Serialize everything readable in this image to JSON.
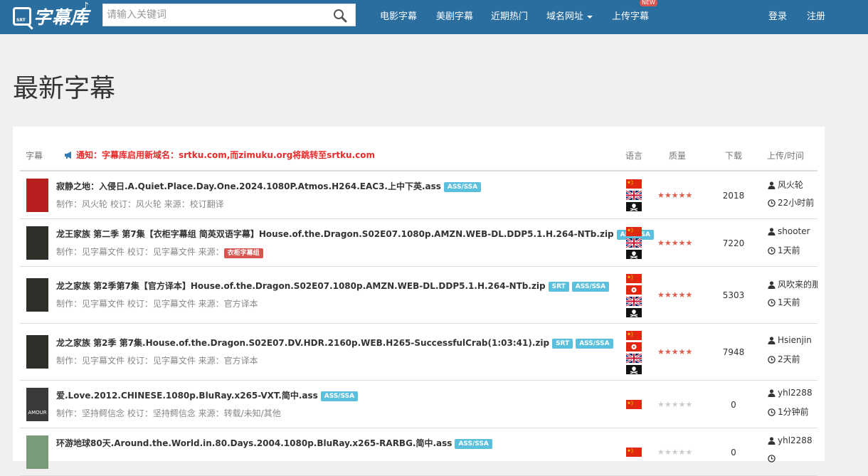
{
  "site": {
    "logo_text": "字幕库",
    "logo_mark_text": "SRT",
    "logo_note": "♪"
  },
  "search": {
    "placeholder": "请输入关键词"
  },
  "nav": {
    "items": [
      "电影字幕",
      "美剧字幕",
      "近期热门",
      "域名网址",
      "上传字幕"
    ],
    "new_badge": "NEW",
    "login": "登录",
    "register": "注册"
  },
  "page_title": "最新字幕",
  "table": {
    "headers": {
      "subtitle": "字幕",
      "language": "语言",
      "quality": "质量",
      "downloads": "下载",
      "uploader_time": "上传/时间"
    },
    "notice": "通知：字幕库启用新域名：srtku.com,而zimuku.org将跳转至srtku.com",
    "rows": [
      {
        "title": "寂静之地：入侵日.A.Quiet.Place.Day.One.2024.1080P.Atmos.H264.EAC3.上中下英.ass",
        "tags": [
          "ASS/SSA"
        ],
        "meta": "制作：风火轮 校订：风火轮 来源：校订翻译",
        "source_badge": "",
        "flags": [
          "cn",
          "uk",
          "skull"
        ],
        "stars": 5,
        "downloads": "2018",
        "uploader": "风火轮",
        "time": "22小时前",
        "poster_color": "#b71f1f"
      },
      {
        "title": "龙王家族 第二季 第7集【衣柜字幕组 简英双语字幕】House.of.the.Dragon.S02E07.1080p.AMZN.WEB-DL.DDP5.1.H.264-NTb.zip",
        "tags": [
          "ASS/SSA"
        ],
        "meta": "制作：见字幕文件 校订：见字幕文件 来源：",
        "source_badge": "衣柜字幕组",
        "flags": [
          "cn",
          "uk",
          "skull"
        ],
        "stars": 5,
        "downloads": "7220",
        "uploader": "shooter",
        "time": "1天前",
        "poster_color": "#2c3028"
      },
      {
        "title": "龙之家族 第2季第7集【官方译本】House.of.the.Dragon.S02E07.1080p.AMZN.WEB-DL.DDP5.1.H.264-NTb.zip",
        "tags": [
          "SRT",
          "ASS/SSA"
        ],
        "meta": "制作：见字幕文件 校订：见字幕文件 来源：官方译本",
        "source_badge": "",
        "flags": [
          "cn",
          "hk",
          "uk",
          "skull"
        ],
        "stars": 5,
        "downloads": "5303",
        "uploader": "风吹来的那",
        "time": "1天前",
        "poster_color": "#2c3028"
      },
      {
        "title": "龙之家族 第2季 第7集.House.of.the.Dragon.S02E07.DV.HDR.2160p.WEB.H265-SuccessfulCrab(1:03:41).zip",
        "tags": [
          "SRT",
          "ASS/SSA"
        ],
        "meta": "制作：见字幕文件 校订：见字幕文件 来源：官方译本",
        "source_badge": "",
        "flags": [
          "cn",
          "hk",
          "uk",
          "skull"
        ],
        "stars": 5,
        "downloads": "7948",
        "uploader": "Hsienjin",
        "time": "2天前",
        "poster_color": "#2c3028"
      },
      {
        "title": "爱.Love.2012.CHINESE.1080p.BluRay.x265-VXT.简中.ass",
        "tags": [
          "ASS/SSA"
        ],
        "meta": "制作：坚持鳄信念 校订：坚持鳄信念 来源：转载/未知/其他",
        "source_badge": "",
        "flags": [
          "cn"
        ],
        "stars": 0,
        "downloads": "0",
        "uploader": "yhl2288",
        "time": "1分钟前",
        "poster_color": "#3a3a3a",
        "poster_text": "AMOUR"
      },
      {
        "title": "环游地球80天.Around.the.World.in.80.Days.2004.1080p.BluRay.x265-RARBG.简中.ass",
        "tags": [
          "ASS/SSA"
        ],
        "meta": "",
        "source_badge": "",
        "flags": [
          "cn"
        ],
        "stars": 0,
        "downloads": "0",
        "uploader": "yhl2288",
        "time": "",
        "poster_color": "#7a9b7a"
      }
    ]
  },
  "colors": {
    "navbar": "#2a6ea0",
    "notice": "#e52b2b",
    "tag": "#5bc0de",
    "star": "#e05c4b"
  }
}
